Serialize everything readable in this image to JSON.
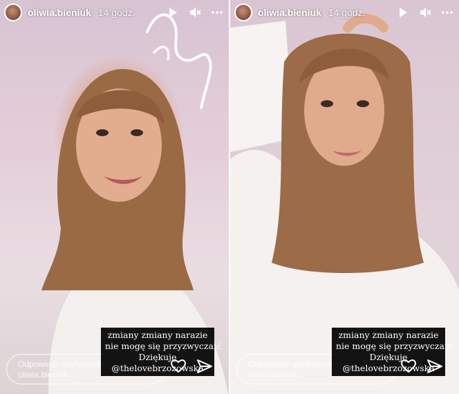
{
  "stories": [
    {
      "username": "oliwia.bieniuk",
      "time": "14 godz.",
      "caption": [
        "zmiany zmiany narazie",
        "nie mogę się przyzwyczaić",
        "Dziękuję",
        "@thelovebrzozowska"
      ],
      "reply_placeholder": "Odpowiedz użytkownikowi oliwia.bieniuk..."
    },
    {
      "username": "oliwia.bieniuk",
      "time": "14 godz.",
      "caption": [
        "zmiany zmiany narazie",
        "nie mogę się przyzwyczaić",
        "Dziękuję",
        "@thelovebrzozowska"
      ],
      "reply_placeholder": "Odpowiedz użytkownikowi oliwia.bieniuk..."
    }
  ],
  "icons": {
    "play": "play-icon",
    "mute": "mute-icon",
    "more": "more-icon",
    "like": "heart-icon",
    "share": "send-icon"
  }
}
